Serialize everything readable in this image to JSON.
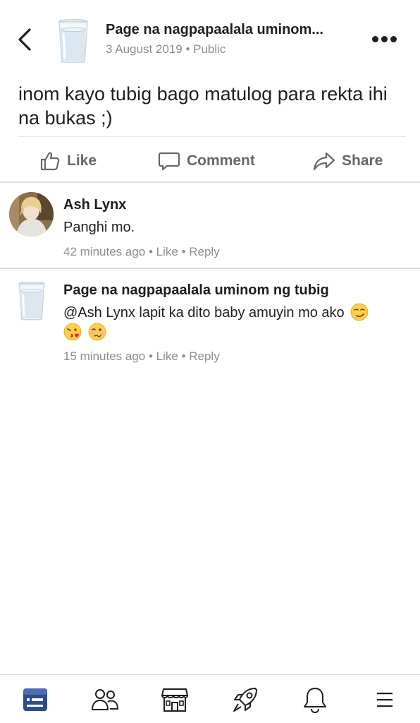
{
  "header": {
    "page_name": "Page na nagpapaalala uminom...",
    "date": "3 August 2019",
    "separator": " • ",
    "visibility": "Public"
  },
  "post": {
    "text": "inom kayo tubig bago matulog para rekta ihi na bukas ;)"
  },
  "actions": {
    "like": "Like",
    "comment": "Comment",
    "share": "Share"
  },
  "comments": [
    {
      "author": "Ash Lynx",
      "text": "Panghi mo.",
      "time": "42 minutes ago",
      "like": "Like",
      "reply": "Reply",
      "dot": " • "
    },
    {
      "author": "Page na nagpapaalala uminom ng tubig",
      "text": "@Ash Lynx lapit ka dito baby amuyin mo ako",
      "time": "15 minutes ago",
      "like": "Like",
      "reply": "Reply",
      "dot": " • "
    }
  ],
  "icons": {
    "back": "chevron-left-icon",
    "more": "more-dots-icon",
    "nav": [
      "news-feed-icon",
      "friends-icon",
      "marketplace-icon",
      "rocket-icon",
      "notifications-bell-icon",
      "menu-icon"
    ]
  },
  "colors": {
    "text": "#1c1e21",
    "muted": "#65676b",
    "meta": "#8a8d91",
    "active_nav": "#2d4c8c"
  }
}
